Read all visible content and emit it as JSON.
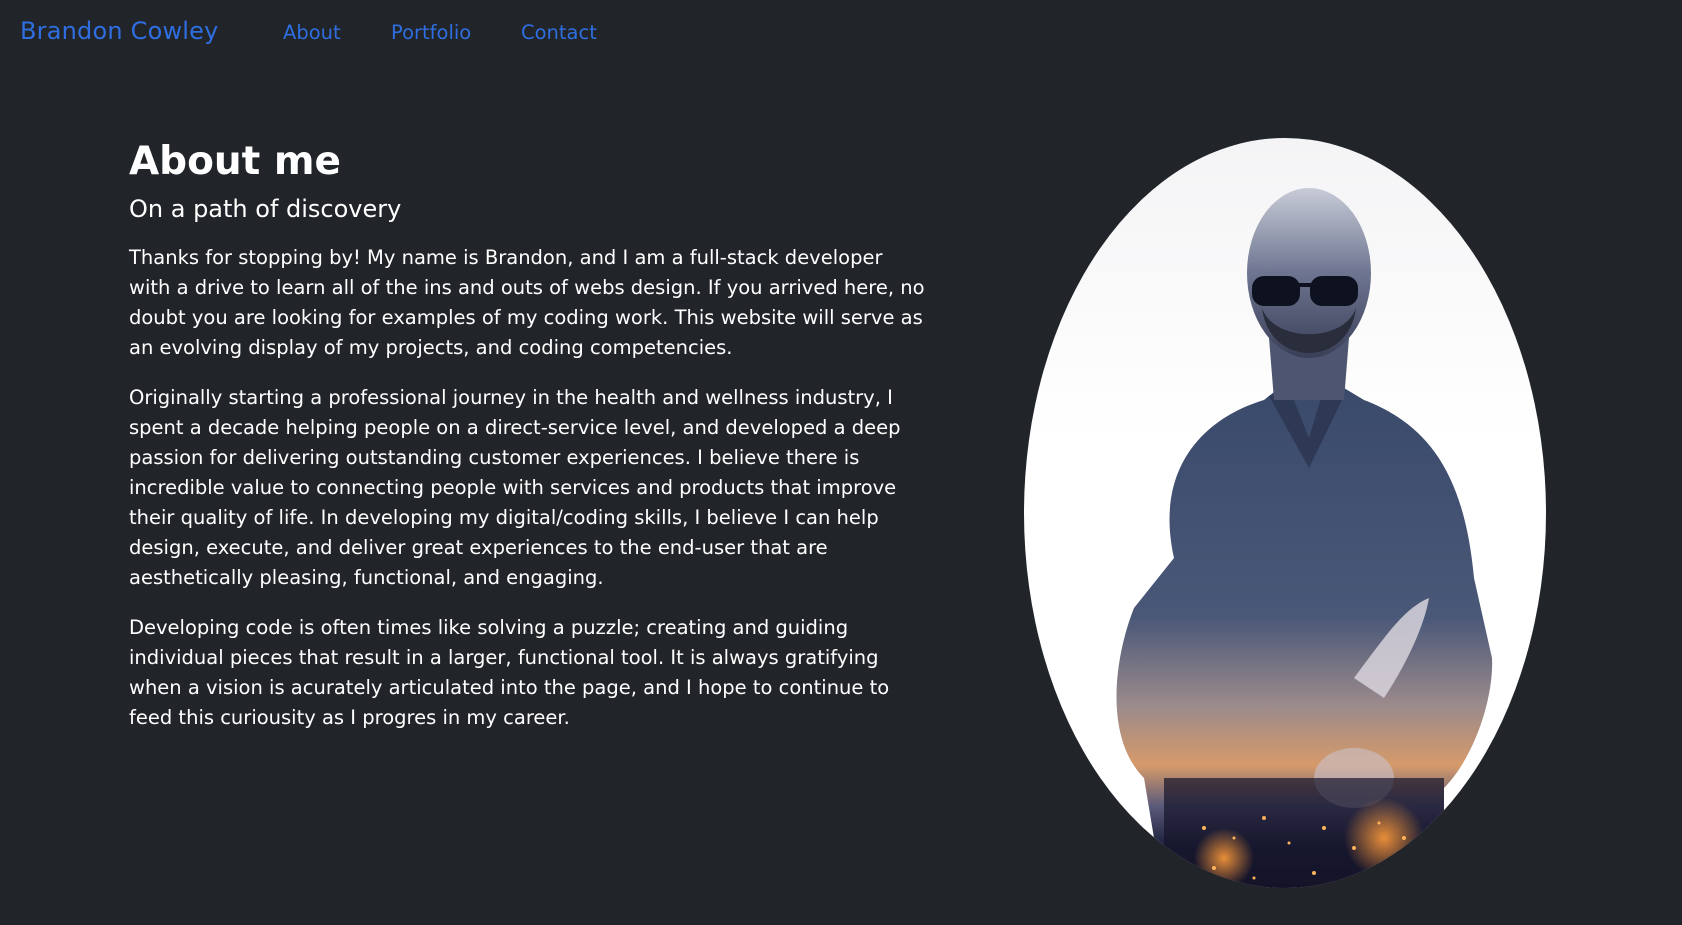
{
  "nav": {
    "brand": "Brandon Cowley",
    "links": [
      "About",
      "Portfolio",
      "Contact"
    ]
  },
  "about": {
    "title": "About me",
    "subtitle": "On a path of discovery",
    "paragraphs": [
      "Thanks for stopping by! My name is Brandon, and I am a full-stack developer with a drive to learn all of the ins and outs of webs design. If you arrived here, no doubt you are looking for examples of my coding work. This website will serve as an evolving display of my projects, and coding competencies.",
      "Originally starting a professional journey in the health and wellness industry, I spent a decade helping people on a direct-service level, and developed a deep passion for delivering outstanding customer experiences. I believe there is incredible value to connecting people with services and products that improve their quality of life. In developing my digital/coding skills, I believe I can help design, execute, and deliver great experiences to the end-user that are aesthetically pleasing, functional, and engaging.",
      "Developing code is often times like solving a puzzle; creating and guiding individual pieces that result in a larger, functional tool. It is always gratifying when a vision is acurately articulated into the page, and I hope to continue to feed this curiousity as I progres in my career."
    ]
  },
  "colors": {
    "background": "#212529",
    "link": "#2f6ee0",
    "text": "#ffffff"
  }
}
